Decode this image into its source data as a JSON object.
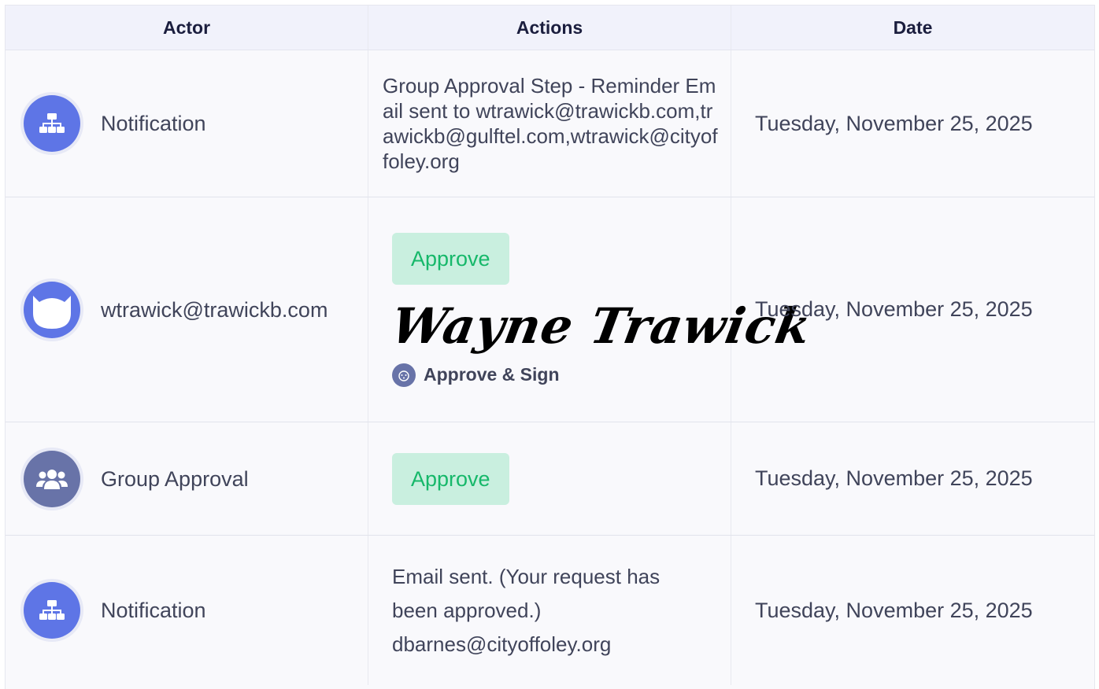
{
  "table": {
    "headers": {
      "actor": "Actor",
      "actions": "Actions",
      "date": "Date"
    },
    "rows": [
      {
        "actor": "Notification",
        "icon": "sitemap-icon",
        "action_text": "Group Approval Step - Reminder Email sent to wtrawick@trawickb.com,trawickb@gulftel.com,wtrawick@cityoffoley.org",
        "date": "Tuesday, November 25, 2025"
      },
      {
        "actor": "wtrawick@trawickb.com",
        "icon": "cat-avatar-icon",
        "approve_label": "Approve",
        "signature": "Wayne Trawick",
        "approve_sign_label": "Approve & Sign",
        "date": "Tuesday, November 25, 2025"
      },
      {
        "actor": "Group Approval",
        "icon": "users-icon",
        "approve_label": "Approve",
        "date": "Tuesday, November 25, 2025"
      },
      {
        "actor": "Notification",
        "icon": "sitemap-icon",
        "action_text": "Email sent. (Your request has been approved.) dbarnes@cityoffoley.org",
        "date": "Tuesday, November 25, 2025"
      }
    ]
  },
  "colors": {
    "accent_blue": "#5e75e6",
    "group_icon": "#6873a8",
    "approve_bg": "#c9efdf",
    "approve_text": "#16b86a"
  }
}
